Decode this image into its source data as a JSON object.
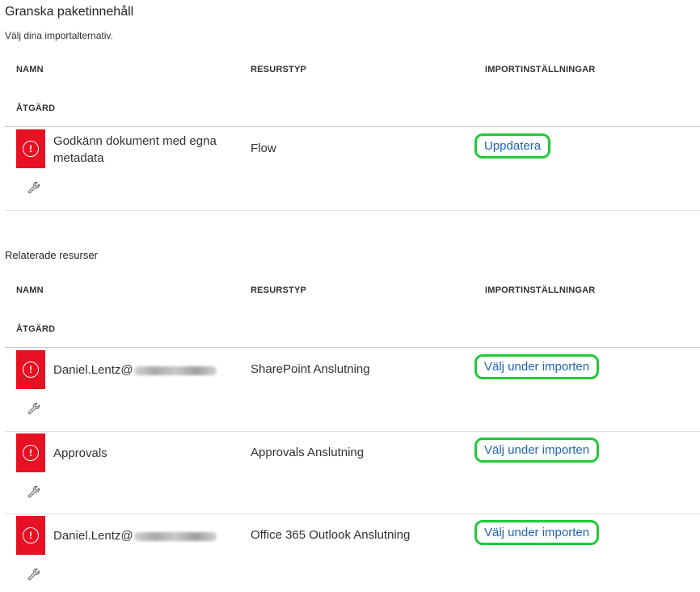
{
  "header": {
    "title": "Granska paketinnehåll",
    "subtitle": "Välj dina importalternativ."
  },
  "columns": {
    "name": "NAMN",
    "resource_type": "RESURSTYP",
    "import_settings": "IMPORTINSTÄLLNINGAR",
    "action": "ÅTGÄRD"
  },
  "package_rows": [
    {
      "name_line1": "Godkänn dokument med egna",
      "name_line2": "metadata",
      "resource_type": "Flow",
      "import_setting": "Uppdatera",
      "status_icon": "error-icon",
      "action_icon": "wrench-icon"
    }
  ],
  "related": {
    "title": "Relaterade resurser",
    "rows": [
      {
        "name": "Daniel.Lentz@",
        "resource_type": "SharePoint Anslutning",
        "import_setting": "Välj under importen",
        "status_icon": "error-icon",
        "action_icon": "wrench-icon"
      },
      {
        "name": "Approvals",
        "resource_type": "Approvals Anslutning",
        "import_setting": "Välj under importen",
        "status_icon": "error-icon",
        "action_icon": "wrench-icon"
      },
      {
        "name": "Daniel.Lentz@",
        "resource_type": "Office 365 Outlook Anslutning",
        "import_setting": "Välj under importen",
        "status_icon": "error-icon",
        "action_icon": "wrench-icon"
      }
    ]
  },
  "colors": {
    "error_tile": "#e81123",
    "highlight_border": "#22c83a",
    "link": "#1e64b4"
  }
}
